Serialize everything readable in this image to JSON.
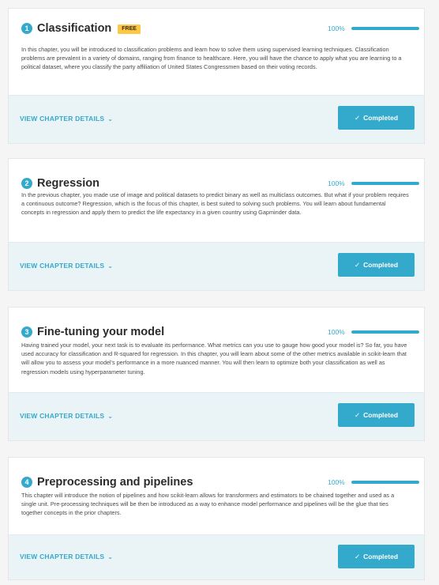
{
  "colors": {
    "accent": "#33aacc",
    "badge": "#ffc844",
    "footer_bg": "#eaf4f7"
  },
  "chapters": [
    {
      "number": "1",
      "title": "Classification",
      "badge": "FREE",
      "progress_label": "100%",
      "progress": 1.0,
      "description": "In this chapter, you will be introduced to classification problems and learn how to solve them using supervised learning techniques. Classification problems are prevalent in a variety of domains, ranging from finance to healthcare. Here, you will have the chance to apply what you are learning to a political dataset, where you classify the party affiliation of United States Congressmen based on their voting records.",
      "details_label": "VIEW CHAPTER DETAILS",
      "status_label": "Completed"
    },
    {
      "number": "2",
      "title": "Regression",
      "progress_label": "100%",
      "progress": 1.0,
      "description": "In the previous chapter, you made use of image and political datasets to predict binary as well as multiclass outcomes. But what if your problem requires a continuous outcome? Regression, which is the focus of this chapter, is best suited to solving such problems. You will learn about fundamental concepts in regression and apply them to predict the life expectancy in a given country using Gapminder data.",
      "details_label": "VIEW CHAPTER DETAILS",
      "status_label": "Completed"
    },
    {
      "number": "3",
      "title": "Fine-tuning your model",
      "progress_label": "100%",
      "progress": 1.0,
      "description": "Having trained your model, your next task is to evaluate its performance. What metrics can you use to gauge how good your model is? So far, you have used accuracy for classification and R-squared for regression. In this chapter, you will learn about some of the other metrics available in scikit-learn that will allow you to assess your model's performance in a more nuanced manner. You will then learn to optimize both your classification as well as regression models using hyperparameter tuning.",
      "details_label": "VIEW CHAPTER DETAILS",
      "status_label": "Completed"
    },
    {
      "number": "4",
      "title": "Preprocessing and pipelines",
      "progress_label": "100%",
      "progress": 1.0,
      "description": "This chapter will introduce the notion of pipelines and how scikit-learn allows for transformers and estimators to be chained together and used as a single unit. Pre-processing techniques will be then be introduced as a way to enhance model performance and pipelines will be the glue that ties together concepts in the prior chapters.",
      "details_label": "VIEW CHAPTER DETAILS",
      "status_label": "Completed"
    }
  ]
}
